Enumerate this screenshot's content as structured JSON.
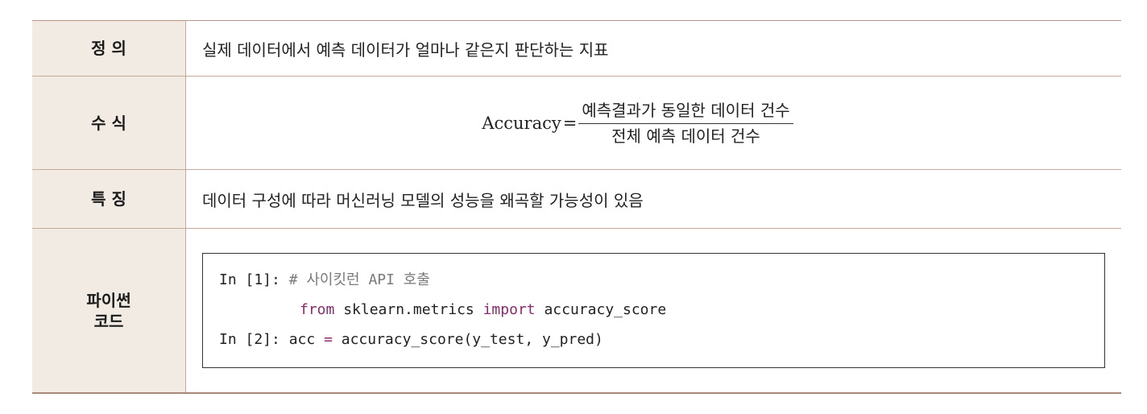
{
  "rows": {
    "definition": {
      "label": "정 의",
      "text": "실제 데이터에서 예측 데이터가 얼마나 같은지 판단하는 지표"
    },
    "formula": {
      "label": "수 식",
      "name": "Accuracy",
      "equals": "=",
      "numerator": "예측결과가 동일한 데이터 건수",
      "denominator": "전체 예측 데이터 건수"
    },
    "feature": {
      "label": "특 징",
      "text": "데이터 구성에 따라 머신러닝 모델의 성능을 왜곡할 가능성이 있음"
    },
    "code": {
      "label_line1": "파이썬",
      "label_line2": "코드",
      "lines": {
        "l1_prompt": "In [1]: ",
        "l1_comment": "# 사이킷런 API 호출",
        "l2_kw1": "from",
        "l2_mod": " sklearn.metrics ",
        "l2_kw2": "import",
        "l2_name": " accuracy_score",
        "l3_prompt": "In [2]: ",
        "l3_var": "acc ",
        "l3_eq": "=",
        "l3_call": " accuracy_score(y_test, y_pred)"
      }
    }
  },
  "colors": {
    "label_background": "#f2ebe3",
    "border": "#c9a99a",
    "code_keyword": "#8b2a6e",
    "code_comment": "#7a7a7a"
  }
}
